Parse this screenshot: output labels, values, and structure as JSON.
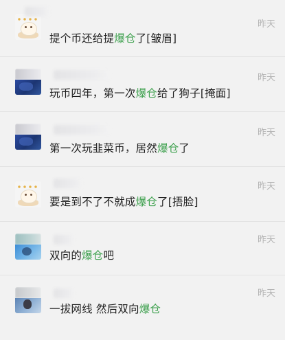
{
  "comments": [
    {
      "avatar": "cartoon-avatar",
      "time": "昨天",
      "text_before": "提个币还给提",
      "highlight": "爆仓",
      "text_after": "了[皱眉]"
    },
    {
      "avatar": "blue-avatar",
      "time": "昨天",
      "text_before": "玩币四年，第一次",
      "highlight": "爆仓",
      "text_after": "给了狗子[掩面]"
    },
    {
      "avatar": "blue-avatar",
      "time": "昨天",
      "text_before": "第一次玩韭菜币，居然",
      "highlight": "爆仓",
      "text_after": "了"
    },
    {
      "avatar": "cartoon-avatar",
      "time": "昨天",
      "text_before": "要是到不了不就成",
      "highlight": "爆仓",
      "text_after": "了[捂脸]"
    },
    {
      "avatar": "teal-avatar",
      "time": "昨天",
      "text_before": "双向的",
      "highlight": "爆仓",
      "text_after": "吧"
    },
    {
      "avatar": "person-avatar",
      "time": "昨天",
      "text_before": "一拔网线 然后双向",
      "highlight": "爆仓",
      "text_after": ""
    }
  ],
  "colors": {
    "background": "#f2f2f2",
    "highlight": "#3fa14f",
    "time": "#b4b4b4",
    "text": "#1e1e1e"
  }
}
